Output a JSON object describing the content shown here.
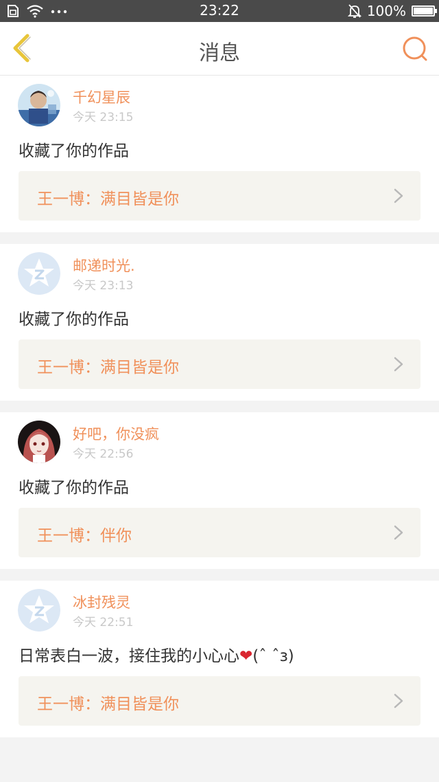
{
  "status_bar": {
    "time": "23:22",
    "battery_text": "100%",
    "battery_level": 1.0,
    "icons": [
      "sim-icon",
      "wifi-icon",
      "more-dots-icon",
      "mute-bell-icon",
      "battery-icon"
    ]
  },
  "nav": {
    "title": "消息",
    "back_icon": "chevron-left-icon",
    "search_icon": "search-icon"
  },
  "messages": [
    {
      "username": "千幻星辰",
      "time": "今天 23:15",
      "content": "收藏了你的作品",
      "work_title": "王一博：满目皆是你",
      "avatar": "photo-avatar-child"
    },
    {
      "username": "邮递时光.",
      "time": "今天 23:13",
      "content": "收藏了你的作品",
      "work_title": "王一博：满目皆是你",
      "avatar": "default-avatar"
    },
    {
      "username": "好吧，你没疯",
      "time": "今天 22:56",
      "content": "收藏了你的作品",
      "work_title": "王一博：伴你",
      "avatar": "anime-girl-avatar"
    },
    {
      "username": "冰封残灵",
      "time": "今天 22:51",
      "content_prefix": "日常表白一波，接住我的小心心",
      "content_emoji": "❤",
      "content_suffix": "(ˆ   ˆз)",
      "work_title": "王一博：满目皆是你",
      "avatar": "default-avatar"
    }
  ],
  "colors": {
    "accent": "#f0905a",
    "back_icon": "#e8c53a",
    "status_bar_bg": "#4a4a4a",
    "work_bg": "#f5f4ef"
  }
}
